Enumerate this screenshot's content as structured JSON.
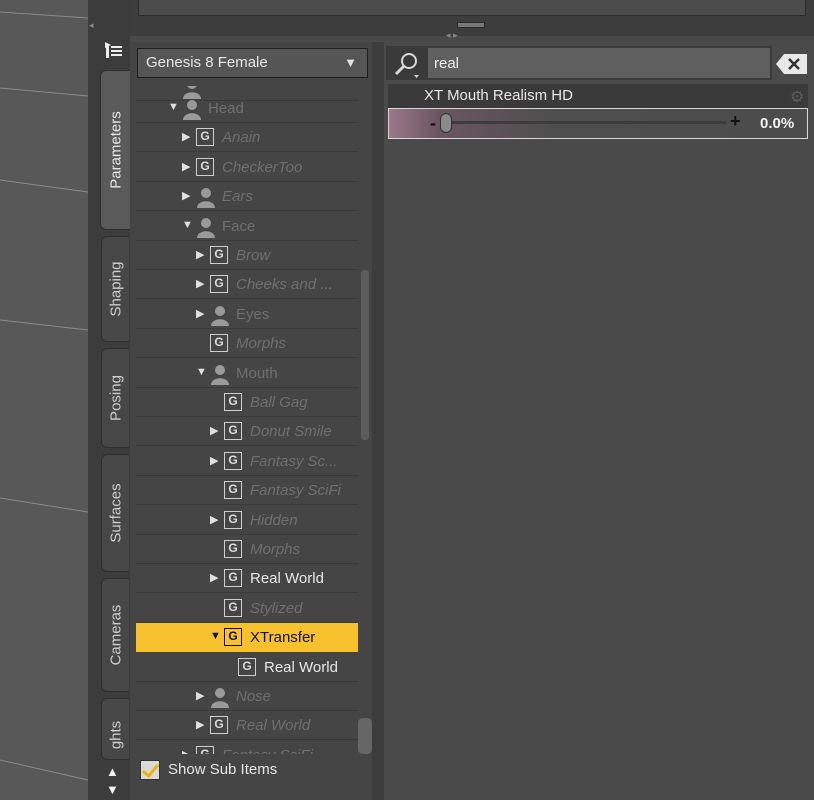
{
  "tabs": {
    "parameters": "Parameters",
    "shaping": "Shaping",
    "posing": "Posing",
    "surfaces": "Surfaces",
    "cameras": "Cameras",
    "lights": "ghts"
  },
  "figure_selector": {
    "value": "Genesis 8 Female"
  },
  "tree": {
    "rows": [
      {
        "label": "Head",
        "icon": "person-icon",
        "expander": "expanded"
      },
      {
        "label": "Anain",
        "icon": "group-icon",
        "expander": "collapsed"
      },
      {
        "label": "CheckerToo",
        "icon": "group-icon",
        "expander": "collapsed"
      },
      {
        "label": "Ears",
        "icon": "person-icon",
        "expander": "collapsed"
      },
      {
        "label": "Face",
        "icon": "person-icon",
        "expander": "expanded"
      },
      {
        "label": "Brow",
        "icon": "group-icon",
        "expander": "collapsed"
      },
      {
        "label": "Cheeks and ...",
        "icon": "group-icon",
        "expander": "collapsed"
      },
      {
        "label": "Eyes",
        "icon": "person-icon",
        "expander": "collapsed"
      },
      {
        "label": "Morphs",
        "icon": "group-icon",
        "expander": "none"
      },
      {
        "label": "Mouth",
        "icon": "person-icon",
        "expander": "expanded"
      },
      {
        "label": "Ball Gag",
        "icon": "group-icon",
        "expander": "none"
      },
      {
        "label": "Donut Smile",
        "icon": "group-icon",
        "expander": "collapsed"
      },
      {
        "label": "Fantasy Sc...",
        "icon": "group-icon",
        "expander": "collapsed"
      },
      {
        "label": "Fantasy SciFi",
        "icon": "group-icon",
        "expander": "none"
      },
      {
        "label": "Hidden",
        "icon": "group-icon",
        "expander": "collapsed"
      },
      {
        "label": "Morphs",
        "icon": "group-icon",
        "expander": "none"
      },
      {
        "label": "Real World",
        "icon": "group-icon",
        "expander": "collapsed"
      },
      {
        "label": "Stylized",
        "icon": "group-icon",
        "expander": "none"
      },
      {
        "label": "XTransfer",
        "icon": "group-icon",
        "expander": "expanded"
      },
      {
        "label": "Real World",
        "icon": "group-icon",
        "expander": "none"
      },
      {
        "label": "Nose",
        "icon": "person-icon",
        "expander": "collapsed"
      },
      {
        "label": "Real World",
        "icon": "group-icon",
        "expander": "collapsed"
      },
      {
        "label": "Fantasy SciFi",
        "icon": "group-icon",
        "expander": "collapsed"
      }
    ]
  },
  "show_sub_items": {
    "label": "Show Sub Items",
    "checked": true
  },
  "search": {
    "value": "real"
  },
  "property": {
    "name": "XT Mouth Realism HD",
    "value": "0.0%",
    "level": 0.0
  },
  "colors": {
    "selection": "#f7c02d",
    "checkmark": "#f0b400",
    "background": "#4a4a4a"
  }
}
